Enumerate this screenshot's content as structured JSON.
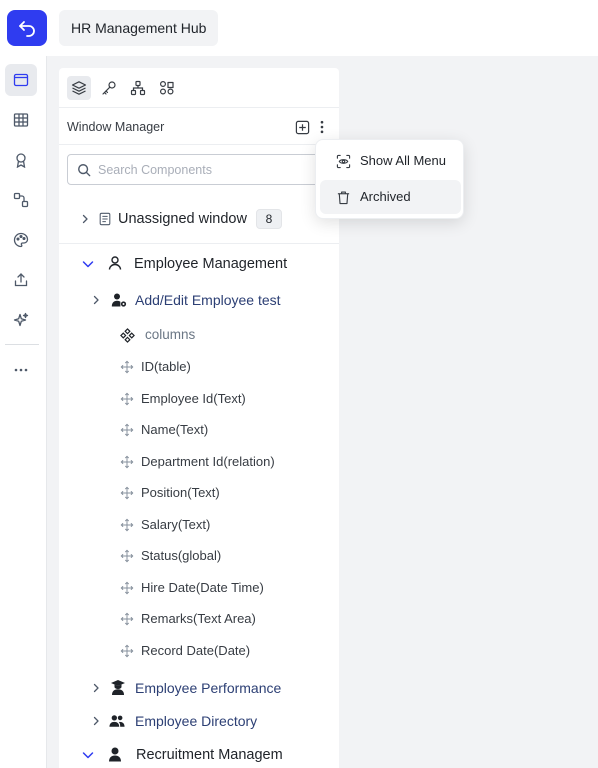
{
  "header": {
    "title": "HR Management Hub"
  },
  "sidebar": {
    "items": [
      {
        "icon": "window-icon",
        "active": true
      },
      {
        "icon": "table-icon",
        "active": false
      },
      {
        "icon": "badge-icon",
        "active": false
      },
      {
        "icon": "workflow-icon",
        "active": false
      },
      {
        "icon": "palette-icon",
        "active": false
      },
      {
        "icon": "export-icon",
        "active": false
      },
      {
        "icon": "ai-sparkle-icon",
        "active": false
      },
      {
        "icon": "more-icon",
        "active": false
      }
    ]
  },
  "panel": {
    "toolbar": [
      "layers-icon",
      "key-icon",
      "hierarchy-icon",
      "components-icon"
    ],
    "title": "Window Manager",
    "search_placeholder": "Search Components",
    "tree": {
      "unassigned": {
        "label": "Unassigned window",
        "count": "8"
      },
      "employee_management": {
        "label": "Employee Management",
        "add_edit": "Add/Edit Employee test",
        "columns_label": "columns",
        "fields": [
          "ID(table)",
          "Employee Id(Text)",
          "Name(Text)",
          "Department Id(relation)",
          "Position(Text)",
          "Salary(Text)",
          "Status(global)",
          "Hire Date(Date Time)",
          "Remarks(Text Area)",
          "Record Date(Date)"
        ],
        "performance": "Employee Performance",
        "directory": "Employee Directory"
      },
      "recruitment": {
        "label": "Recruitment Managem"
      }
    }
  },
  "popup_menu": {
    "items": [
      {
        "label": "Show All Menu",
        "icon": "eye-scan-icon"
      },
      {
        "label": "Archived",
        "icon": "trash-icon"
      }
    ]
  },
  "colors": {
    "accent": "#2f3cf0",
    "navy_text": "#2c3f74"
  }
}
